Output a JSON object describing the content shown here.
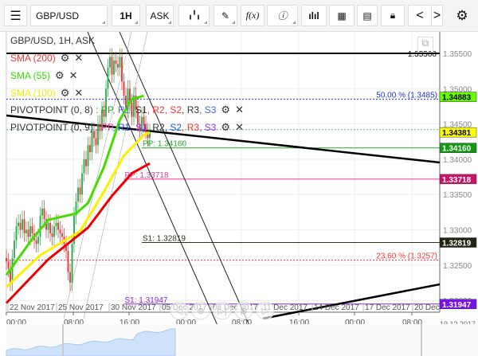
{
  "toolbar": {
    "menu_icon": "hamburger-icon",
    "symbol": "GBP/USD",
    "timeframe": "1H",
    "price_type": "ASK",
    "chart_type_icon": "candlestick-icon",
    "draw_icon": "pencil-icon",
    "indicators_label": "f(x)",
    "info_icon": "info-icon",
    "volume_icon": "bar-chart-icon",
    "calendar_icon": "calendar-icon",
    "calculator_icon": "calculator-icon",
    "lock_icon": "lock-icon",
    "prev_icon": "chevron-left-icon",
    "next_icon": "chevron-right-icon",
    "settings_icon": "gear-icon"
  },
  "chart": {
    "title": "GBP/USD, 1H, ASK",
    "indicators": [
      {
        "label": "SMA (200)",
        "color": "#ff3333"
      },
      {
        "label": "SMA (55)",
        "color": "#33dd00"
      },
      {
        "label": "SMA (100)",
        "color": "#eeee00"
      }
    ],
    "pivots": [
      {
        "label": "PIVOTPOINT (0, 8)",
        "parts": [
          {
            "t": ": PP",
            "c": "#22aa22"
          },
          {
            "t": ", R1",
            "c": "#4477cc"
          },
          {
            "t": ", S1",
            "c": "#333"
          },
          {
            "t": ", R2",
            "c": "#ff3333"
          },
          {
            "t": ", S2",
            "c": "#ff3333"
          },
          {
            "t": ", R3",
            "c": "#333"
          },
          {
            "t": ", S3",
            "c": "#4466dd"
          }
        ]
      },
      {
        "label": "PIVOTPOINT (0, 9)",
        "parts": [
          {
            "t": ": PP",
            "c": "#ff3399"
          },
          {
            "t": ", R1",
            "c": "#2255ee"
          },
          {
            "t": ", S1",
            "c": "#8833ff"
          },
          {
            "t": ", R2",
            "c": "#333"
          },
          {
            "t": ", S2",
            "c": "#2255ee"
          },
          {
            "t": ", R3",
            "c": "#ff3333"
          },
          {
            "t": ", S3",
            "c": "#8833ff"
          }
        ]
      }
    ],
    "price_axis": [
      "1.35500",
      "1.35000",
      "1.34500",
      "1.34000",
      "1.33500",
      "1.33000",
      "1.32500",
      "1.32000"
    ],
    "price_ticks": [
      1.355,
      1.35,
      1.345,
      1.34,
      1.335,
      1.33,
      1.325,
      1.32
    ],
    "date_labels": [
      "22 Nov 2017",
      "25 Nov 2017",
      "30 Nov 2017",
      "05 Dec 2017",
      "08 Dec 2017",
      "11 Dec 2017",
      "14 Dec 2017",
      "17 Dec 2017",
      "20 Dec"
    ],
    "time_labels": [
      "00:00",
      "08:00",
      "16:00",
      "00:00",
      "08:00",
      "16:00",
      "00:00",
      "08:00"
    ],
    "end_date": "19.12.2017",
    "levels": [
      {
        "price": 1.355,
        "text": "1.35500",
        "color": "#000000",
        "style": "thick"
      },
      {
        "price": 1.3485,
        "text": "50.00 % (1.3485)",
        "color": "#2233cc",
        "style": "dotted"
      },
      {
        "price": 1.3442,
        "text": "",
        "color": "#66aa88",
        "style": "dotted"
      },
      {
        "price": 1.3416,
        "text": "PP: 1.34160",
        "color": "#22aa22",
        "style": "solid",
        "from_bar": 68
      },
      {
        "price": 1.33718,
        "text": "PP: 1.33718",
        "color": "#ee3399",
        "style": "solid",
        "from_bar": 59
      },
      {
        "price": 1.32819,
        "text": "S1: 1.32819",
        "color": "#333322",
        "style": "solid",
        "from_bar": 68
      },
      {
        "price": 1.3257,
        "text": "23.60 % (1.3257)",
        "color": "#ff3333",
        "style": "dotted"
      },
      {
        "price": 1.31947,
        "text": "S1: 1.31947",
        "color": "#8822ee",
        "style": "solid",
        "from_bar": 59
      }
    ],
    "price_tags": [
      {
        "text": "1.34883",
        "bg": "#66ff00",
        "fg": "#000",
        "price": 1.34883
      },
      {
        "text": "1.34381",
        "bg": "#ffff00",
        "fg": "#000",
        "price": 1.34381
      },
      {
        "text": "1.34160",
        "bg": "#119911",
        "fg": "#fff",
        "price": 1.3416
      },
      {
        "text": "1.33718",
        "bg": "#cc1166",
        "fg": "#fff",
        "price": 1.33718
      },
      {
        "text": "1.32819",
        "bg": "#222211",
        "fg": "#fff",
        "price": 1.32819
      },
      {
        "text": "1.31947",
        "bg": "#7711ee",
        "fg": "#fff",
        "price": 1.31947
      }
    ],
    "closes": [
      1.3255,
      1.3245,
      1.3225,
      1.326,
      1.3285,
      1.3305,
      1.331,
      1.33,
      1.3315,
      1.3295,
      1.33,
      1.329,
      1.3305,
      1.3295,
      1.3285,
      1.328,
      1.329,
      1.332,
      1.333,
      1.3315,
      1.33,
      1.331,
      1.3295,
      1.329,
      1.3305,
      1.331,
      1.33,
      1.3295,
      1.329,
      1.328,
      1.327,
      1.324,
      1.3225,
      1.328,
      1.332,
      1.334,
      1.336,
      1.335,
      1.338,
      1.34,
      1.339,
      1.342,
      1.341,
      1.344,
      1.343,
      1.342,
      1.345,
      1.344,
      1.347,
      1.346,
      1.35,
      1.353,
      1.3545,
      1.352,
      1.354,
      1.3535,
      1.353,
      1.3545,
      1.351,
      1.349,
      1.347,
      1.35,
      1.348,
      1.346,
      1.349,
      1.347,
      1.345,
      1.344,
      1.346,
      1.345,
      1.344,
      1.343,
      1.3438
    ],
    "sma55": [
      [
        0,
        1.3236
      ],
      [
        13,
        1.3287
      ],
      [
        21,
        1.3314
      ],
      [
        35,
        1.3323
      ],
      [
        41,
        1.3338
      ],
      [
        49,
        1.3389
      ],
      [
        57,
        1.3456
      ],
      [
        63,
        1.3485
      ],
      [
        69,
        1.349
      ]
    ],
    "sma100": [
      [
        0,
        1.3219
      ],
      [
        17,
        1.3264
      ],
      [
        37,
        1.3298
      ],
      [
        49,
        1.3354
      ],
      [
        59,
        1.3405
      ],
      [
        69,
        1.3434
      ],
      [
        72,
        1.3438
      ]
    ],
    "sma200": [
      [
        0,
        1.3196
      ],
      [
        21,
        1.3258
      ],
      [
        41,
        1.3303
      ],
      [
        53,
        1.3348
      ],
      [
        63,
        1.338
      ],
      [
        72,
        1.3394
      ]
    ],
    "nav_icons": [
      "nav-back-icon",
      "zoom-out-icon",
      "nav-end-icon",
      "zoom-in-icon",
      "nav-forward-icon"
    ]
  }
}
